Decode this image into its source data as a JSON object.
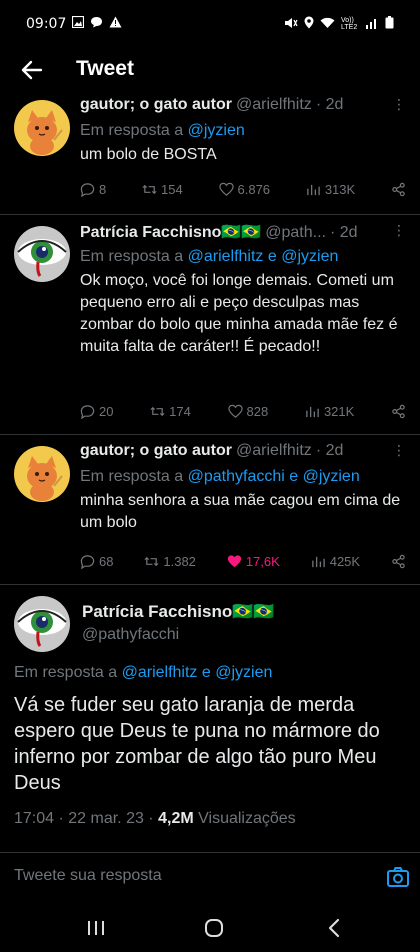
{
  "status_bar": {
    "time": "09:07",
    "network": "Vo)) LTE2"
  },
  "header": {
    "title": "Tweet"
  },
  "replies": [
    {
      "name": "gautor; o gato autor",
      "handle": "@arielfhitz",
      "time": "· 2d",
      "reply_prefix": "Em resposta a",
      "reply_to": "@jyzien",
      "text": "um bolo de BOSTA",
      "counts": {
        "replies": "8",
        "retweets": "154",
        "likes": "6.876",
        "views": "313K"
      },
      "liked": false
    },
    {
      "name": "Patrícia Facchisno🇧🇷🇧🇷",
      "handle": "@path...",
      "time": "· 2d",
      "reply_prefix": "Em resposta a",
      "reply_to": "@arielfhitz e @jyzien",
      "text": "Ok moço, você foi longe demais. Cometi um pequeno erro ali e peço desculpas mas zombar do bolo que minha amada mãe fez é muita falta de caráter!! É pecado!!",
      "counts": {
        "replies": "20",
        "retweets": "174",
        "likes": "828",
        "views": "321K"
      },
      "liked": false
    },
    {
      "name": "gautor; o gato autor",
      "handle": "@arielfhitz",
      "time": "· 2d",
      "reply_prefix": "Em resposta a",
      "reply_to": "@pathyfacchi e @jyzien",
      "text": "minha senhora a sua mãe cagou em cima de um bolo",
      "counts": {
        "replies": "68",
        "retweets": "1.382",
        "likes": "17,6K",
        "views": "425K"
      },
      "liked": true
    }
  ],
  "main_tweet": {
    "name": "Patrícia Facchisno🇧🇷🇧🇷",
    "handle": "@pathyfacchi",
    "reply_prefix": "Em resposta a",
    "reply_to": "@arielfhitz e @jyzien",
    "text": "Vá se fuder seu gato laranja de merda espero que Deus te   puna no mármore do inferno por zombar de algo tão puro Meu Deus",
    "time_date": "17:04 · 22 mar. 23 ·",
    "views_count": "4,2M",
    "views_label": "Visualizações"
  },
  "compose": {
    "placeholder": "Tweete sua resposta"
  },
  "colors": {
    "accent": "#1d9bf0",
    "like": "#f91880",
    "muted": "#71767b",
    "background": "#000000"
  }
}
